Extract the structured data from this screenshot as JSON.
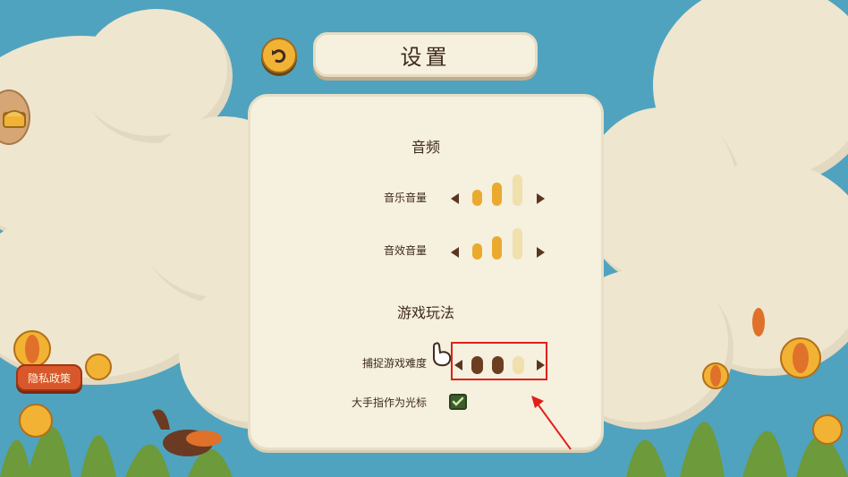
{
  "header": {
    "title": "设置"
  },
  "sections": {
    "audio": {
      "title": "音频",
      "music": {
        "label": "音乐音量",
        "level": 2,
        "max": 3
      },
      "sfx": {
        "label": "音效音量",
        "level": 2,
        "max": 3
      }
    },
    "gameplay": {
      "title": "游戏玩法",
      "difficulty": {
        "label": "捕捉游戏难度",
        "level": 2,
        "max": 3
      },
      "cursor": {
        "label": "大手指作为光标",
        "checked": true
      }
    }
  },
  "footer": {
    "privacy_label": "隐私政策"
  },
  "colors": {
    "sky": "#4fa3bf",
    "panel": "#f6f0de",
    "volume_on": "#eaaa2e",
    "volume_off": "#f0e0ac",
    "difficulty_on": "#6b3e22",
    "difficulty_off": "#f0e0ac",
    "highlight": "#e0201c"
  },
  "icons": [
    "back-arrow-icon",
    "hand-pointer-icon",
    "checkmark-icon",
    "treasure-chest-icon"
  ]
}
